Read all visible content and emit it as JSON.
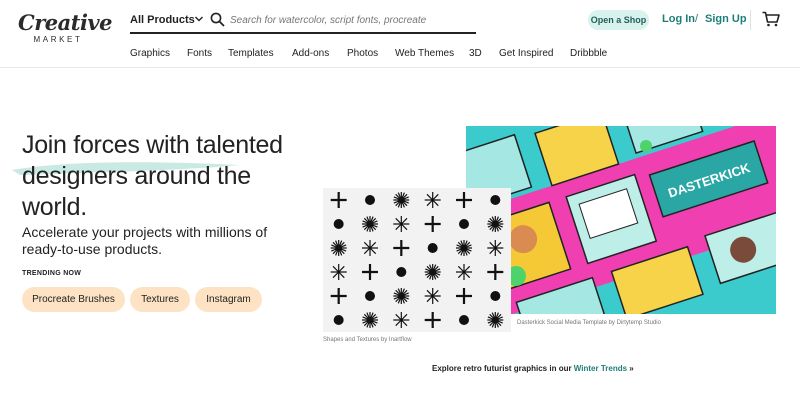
{
  "header": {
    "logo_line1": "Creative",
    "logo_line2": "MARKET",
    "category": "All Products",
    "search_placeholder": "Search for watercolor, script fonts, procreate",
    "open_shop": "Open a Shop",
    "login": "Log In",
    "separator": "/",
    "signup": "Sign Up"
  },
  "nav": {
    "items": [
      "Graphics",
      "Fonts",
      "Templates",
      "Add-ons",
      "Photos",
      "Web Themes",
      "3D",
      "Get Inspired",
      "Dribbble"
    ]
  },
  "hero": {
    "title": "Join forces with talented designers around the world.",
    "subtitle": "Accelerate your projects with millions of ready-to-use products.",
    "trending_label": "TRENDING NOW",
    "chips": [
      "Procreate Brushes",
      "Textures",
      "Instagram"
    ]
  },
  "images": {
    "left_caption": "Shapes and Textures by Inartflow",
    "right_caption": "Dasterkick Social Media Template by Dirtytemp Studio",
    "right_title": "DASTERKICK"
  },
  "explore": {
    "text": "Explore retro futurist graphics in our ",
    "link": "Winter Trends",
    "arrow": " »"
  },
  "colors": {
    "accent": "#1e7e77",
    "chip_bg": "#fde3c3",
    "shop_bg": "#d9f2ee",
    "brush": "#bfe6dd"
  }
}
